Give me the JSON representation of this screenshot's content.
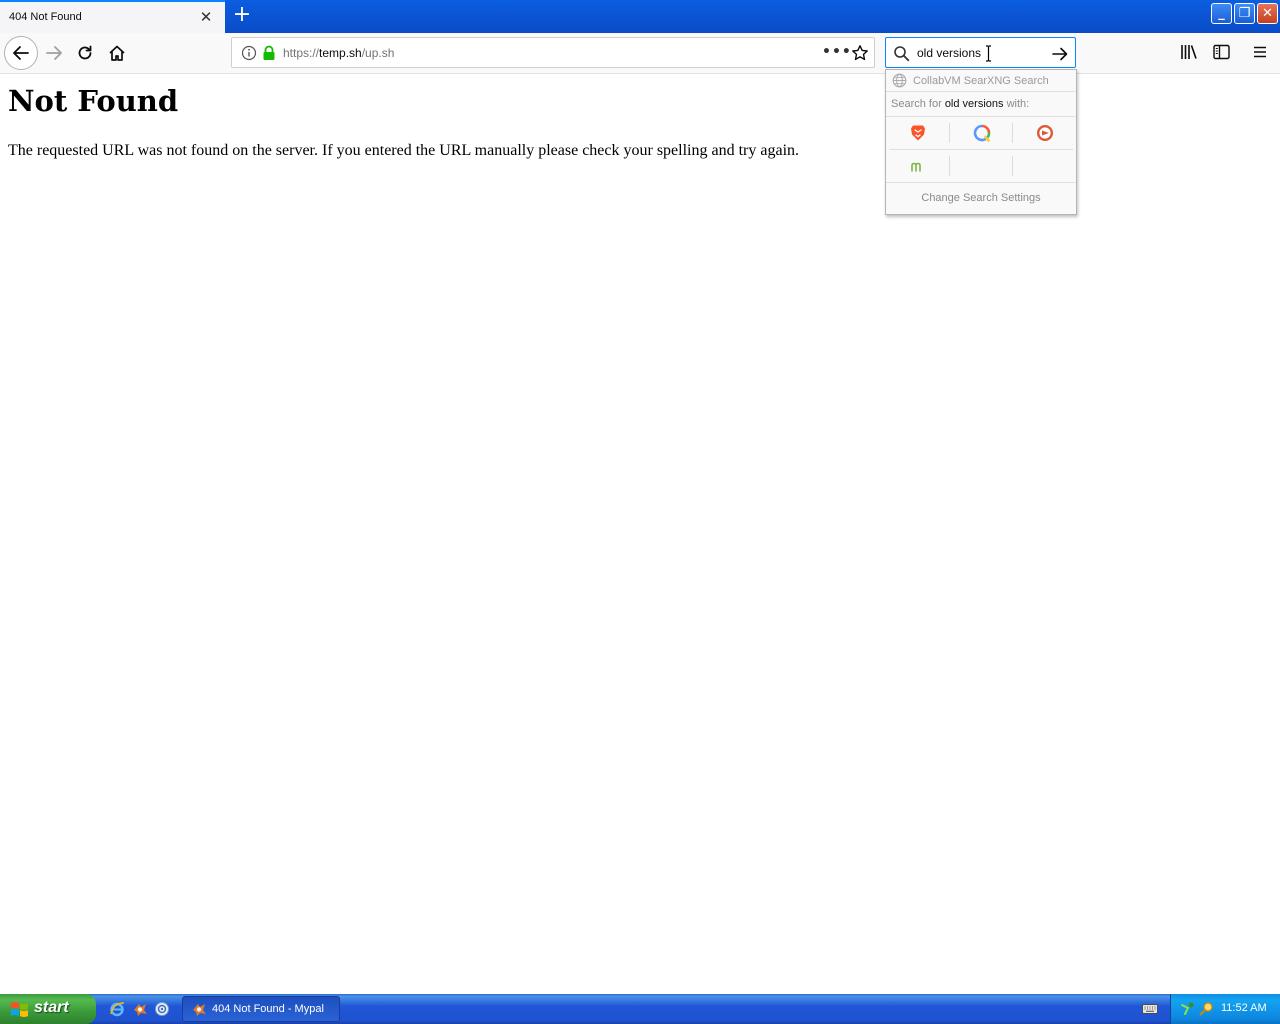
{
  "browser": {
    "tab_title": "404 Not Found",
    "tab_close": "✕",
    "new_tab": "+",
    "url_scheme": "https://",
    "url_host": "temp.sh",
    "url_path": "/up.sh",
    "url_more": "•••",
    "search_query": "old versions"
  },
  "window_controls": {
    "minimize": "_",
    "maximize": "❐",
    "close": "✕"
  },
  "page": {
    "heading": "Not Found",
    "message": "The requested URL was not found on the server. If you entered the URL manually please check your spelling and try again."
  },
  "search_popup": {
    "engine_name": "CollabVM SearXNG Search",
    "search_for_prefix": "Search for ",
    "search_for_query": "old versions",
    "search_for_suffix": " with:",
    "engines": [
      "brave-icon",
      "qwant-icon",
      "duckduckgo-icon",
      "mojeek-icon"
    ],
    "settings_label": "Change Search Settings"
  },
  "taskbar": {
    "start_label": "start",
    "task_label": "404 Not Found - Mypal",
    "clock": "11:52 AM"
  },
  "colors": {
    "accent": "#0a84ff",
    "taskbar_blue": "#245edb",
    "start_green": "#3c9b3c",
    "tray_blue": "#0f8ee8"
  }
}
